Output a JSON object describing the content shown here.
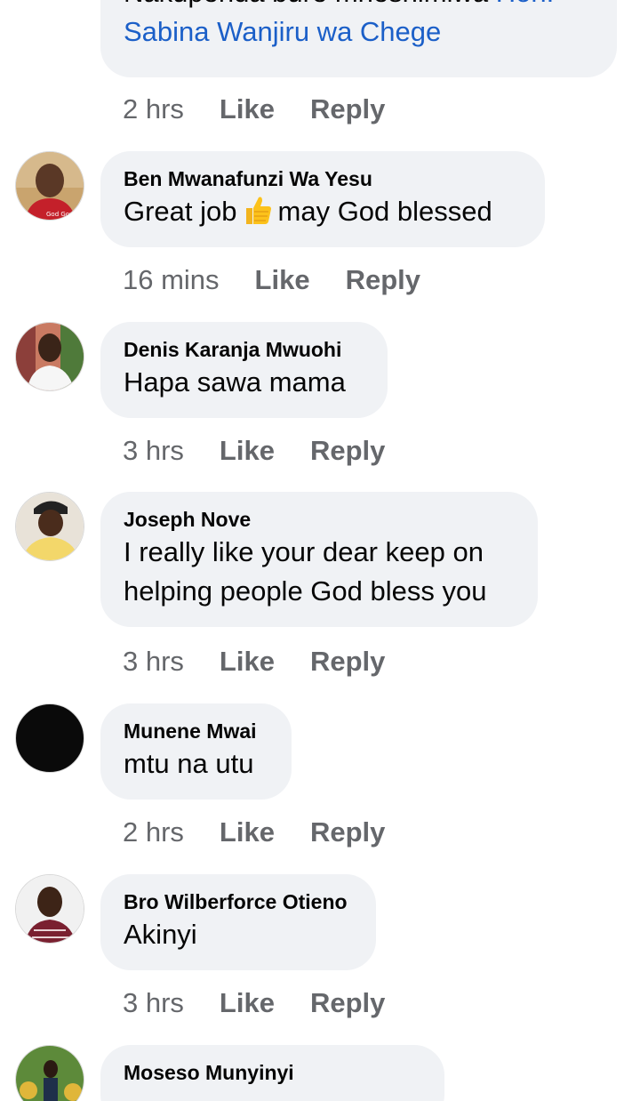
{
  "comments": [
    {
      "partial_line": "Nakupenda bure mheshimiwa",
      "partial_link": "Hon.",
      "text_link": "Sabina Wanjiru wa Chege",
      "time": "2 hrs",
      "like": "Like",
      "reply": "Reply"
    },
    {
      "author": "Ben Mwanafunzi Wa Yesu",
      "text_before": "Great job",
      "emoji": "thumbs-up",
      "text_after": "may God blessed",
      "time": "16 mins",
      "like": "Like",
      "reply": "Reply"
    },
    {
      "author": "Denis Karanja Mwuohi",
      "text": "Hapa sawa mama",
      "time": "3 hrs",
      "like": "Like",
      "reply": "Reply"
    },
    {
      "author": "Joseph Nove",
      "text_line1": "I really like your dear keep on",
      "text_line2": "helping people God bless you",
      "time": "3 hrs",
      "like": "Like",
      "reply": "Reply"
    },
    {
      "author": "Munene Mwai",
      "text": "mtu na utu",
      "time": "2 hrs",
      "like": "Like",
      "reply": "Reply"
    },
    {
      "author": "Bro Wilberforce Otieno",
      "text": "Akinyi",
      "time": "3 hrs",
      "like": "Like",
      "reply": "Reply"
    },
    {
      "author": "Moseso Munyinyi"
    }
  ],
  "colors": {
    "bubble": "#f0f2f5",
    "link": "#1b5fc8",
    "meta": "#65676b"
  }
}
